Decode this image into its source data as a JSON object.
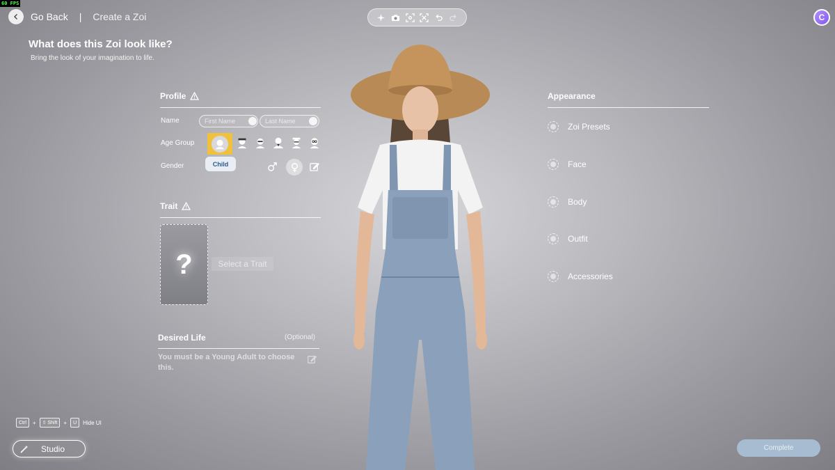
{
  "fps": "60 FPS",
  "nav": {
    "back_label": "Go Back",
    "separator": "|",
    "crumb": "Create a Zoi"
  },
  "toolbar": {
    "icons": [
      "sparkle-icon",
      "camera-icon",
      "focus-icon",
      "capture-icon",
      "undo-icon",
      "redo-icon"
    ]
  },
  "account": {
    "initial": "C"
  },
  "header": {
    "title": "What does this Zoi look like?",
    "subtitle": "Bring the look of your imagination to life."
  },
  "profile": {
    "title": "Profile",
    "name_label": "Name",
    "first_placeholder": "First Name",
    "last_placeholder": "Last Name",
    "age_label": "Age Group",
    "age_selected_tooltip": "Child",
    "gender_label": "Gender"
  },
  "trait": {
    "title": "Trait",
    "card_symbol": "?",
    "select_label": "Select a Trait"
  },
  "desired_life": {
    "title": "Desired Life",
    "optional": "(Optional)",
    "note": "You must be a Young Adult to choose this."
  },
  "appearance": {
    "title": "Appearance",
    "items": [
      "Zoi Presets",
      "Face",
      "Body",
      "Outfit",
      "Accessories"
    ]
  },
  "hotkeys": {
    "k1": "Ctrl",
    "plus": "+",
    "k2": "⇧ Shift",
    "k3": "U",
    "action": "Hide UI"
  },
  "studio": {
    "label": "Studio"
  },
  "complete": {
    "label": "Complete"
  },
  "colors": {
    "accent_selected": "#f0c13c",
    "complete_disabled": "#a7bcd0",
    "tooltip_text": "#2c5a8c"
  }
}
